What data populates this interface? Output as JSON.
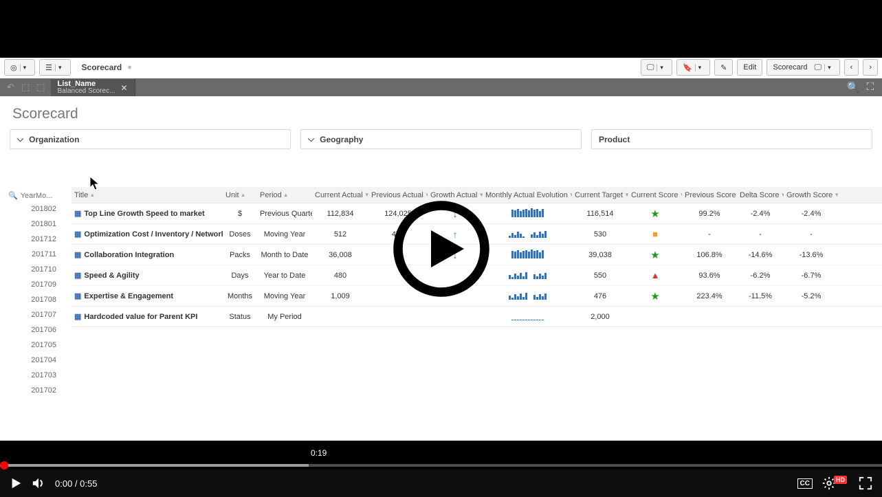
{
  "toolbar": {
    "breadcrumb": "Scorecard",
    "edit_label": "Edit",
    "scorecard_btn_label": "Scorecard"
  },
  "tabchip": {
    "line1": "List_Name",
    "line2": "Balanced Scorec..."
  },
  "page": {
    "title": "Scorecard"
  },
  "filters": {
    "organization": "Organization",
    "geography": "Geography",
    "product": "Product"
  },
  "side": {
    "search_placeholder": "YearMo...",
    "items": [
      "201802",
      "201801",
      "201712",
      "201711",
      "201710",
      "201709",
      "201708",
      "201707",
      "201706",
      "201705",
      "201704",
      "201703",
      "201702"
    ]
  },
  "columns": {
    "title": "Title",
    "unit": "Unit",
    "period": "Period",
    "current_actual": "Current Actual",
    "previous_actual": "Previous Actual",
    "growth_actual": "Growth Actual",
    "monthly_evolution": "Monthly Actual Evolution",
    "current_target": "Current Target",
    "current_score": "Current Score",
    "previous_score": "Previous Score",
    "delta_score": "Delta Score",
    "growth_score": "Growth Score"
  },
  "rows": [
    {
      "title": "Top Line Growth Speed to market",
      "unit": "$",
      "period": "Previous Quarter",
      "current_actual": "112,834",
      "previous_actual": "124,025",
      "growth": "down",
      "target": "116,514",
      "score": "star",
      "prev_score": "99.2%",
      "delta": "-2.4%",
      "growth_score": "-2.4%"
    },
    {
      "title": "Optimization Cost / Inventory / Network",
      "unit": "Doses",
      "period": "Moving Year",
      "current_actual": "512",
      "previous_actual": "479",
      "growth": "up",
      "target": "530",
      "score": "square",
      "prev_score": "-",
      "delta": "-",
      "growth_score": "-"
    },
    {
      "title": "Collaboration Integration",
      "unit": "Packs",
      "period": "Month to Date",
      "current_actual": "36,008",
      "previous_actual": "",
      "growth": "down",
      "target": "39,038",
      "score": "star",
      "prev_score": "106.8%",
      "delta": "-14.6%",
      "growth_score": "-13.6%"
    },
    {
      "title": "Speed & Agility",
      "unit": "Days",
      "period": "Year to Date",
      "current_actual": "480",
      "previous_actual": "",
      "growth": "",
      "target": "550",
      "score": "triangle",
      "prev_score": "93.6%",
      "delta": "-6.2%",
      "growth_score": "-6.7%"
    },
    {
      "title": "Expertise & Engagement",
      "unit": "Months",
      "period": "Moving Year",
      "current_actual": "1,009",
      "previous_actual": "",
      "growth": "",
      "target": "476",
      "score": "star",
      "prev_score": "223.4%",
      "delta": "-11.5%",
      "growth_score": "-5.2%"
    },
    {
      "title": "Hardcoded value for Parent KPI",
      "unit": "Status",
      "period": "My Period",
      "current_actual": "",
      "previous_actual": "",
      "growth": "",
      "target": "2,000",
      "score": "",
      "prev_score": "",
      "delta": "",
      "growth_score": ""
    }
  ],
  "video": {
    "current_time": "0:00",
    "duration": "0:55",
    "hover_time": "0:19",
    "hd_label": "HD",
    "cc_label": "CC"
  }
}
